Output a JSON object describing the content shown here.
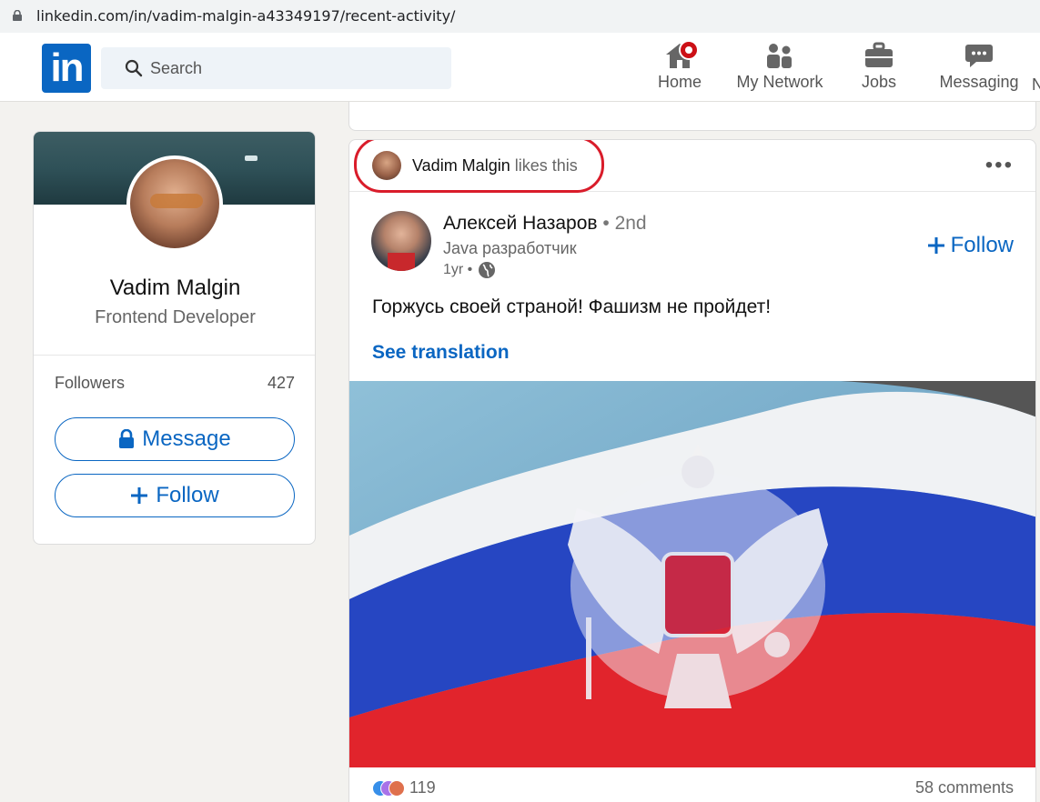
{
  "browser": {
    "url": "linkedin.com/in/vadim-malgin-a43349197/recent-activity/"
  },
  "nav": {
    "logo": "in",
    "search_placeholder": "Search",
    "items": [
      {
        "label": "Home",
        "icon": "home-icon"
      },
      {
        "label": "My Network",
        "icon": "network-icon"
      },
      {
        "label": "Jobs",
        "icon": "briefcase-icon"
      },
      {
        "label": "Messaging",
        "icon": "messaging-icon"
      }
    ],
    "truncated_item": "N"
  },
  "profile": {
    "name": "Vadim Malgin",
    "headline": "Frontend Developer",
    "followers_label": "Followers",
    "followers_count": "427",
    "message_button": "Message",
    "follow_button": "Follow"
  },
  "post": {
    "liker_name": "Vadim Malgin",
    "liker_action": "likes this",
    "author_name": "Алексей Назаров",
    "author_degree": "• 2nd",
    "author_headline": "Java разработчик",
    "time": "1yr •",
    "follow_label": "Follow",
    "text": "Горжусь своей страной! Фашизм не пройдет!",
    "translate_label": "See translation",
    "reaction_count": "119",
    "comments": "58 comments"
  },
  "colors": {
    "brand": "#0a66c2",
    "highlight": "#d91c2a",
    "notification": "#cc1016"
  }
}
